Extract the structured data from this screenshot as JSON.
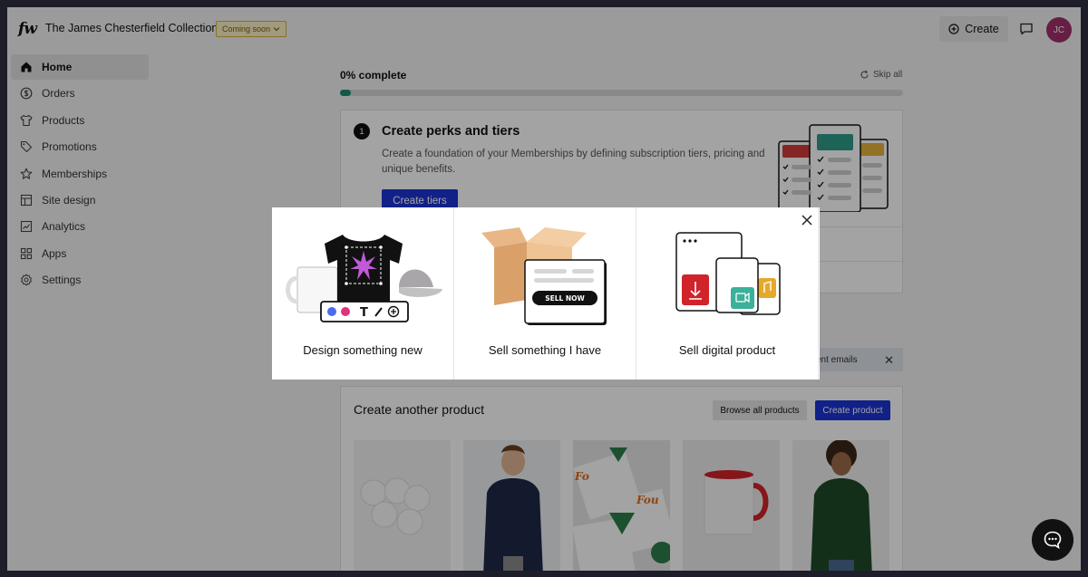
{
  "header": {
    "logo": "fw",
    "store_name": "The James Chesterfield Collection",
    "badge": "Coming soon",
    "create_label": "Create",
    "avatar_initials": "JC"
  },
  "sidebar": {
    "items": [
      {
        "label": "Home",
        "icon": "home-icon"
      },
      {
        "label": "Orders",
        "icon": "dollar-icon"
      },
      {
        "label": "Products",
        "icon": "shirt-icon"
      },
      {
        "label": "Promotions",
        "icon": "tag-icon"
      },
      {
        "label": "Memberships",
        "icon": "star-icon"
      },
      {
        "label": "Site design",
        "icon": "layout-icon"
      },
      {
        "label": "Analytics",
        "icon": "chart-icon"
      },
      {
        "label": "Apps",
        "icon": "grid-icon"
      },
      {
        "label": "Settings",
        "icon": "gear-icon"
      }
    ]
  },
  "progress": {
    "label": "0% complete",
    "skip_label": "Skip all",
    "value_percent": 0
  },
  "perks_card": {
    "step": "1",
    "title": "Create perks and tiers",
    "description": "Create a foundation of your Memberships by defining subscription tiers, pricing and unique benefits.",
    "button_label": "Create tiers"
  },
  "notification": {
    "text": "ent emails"
  },
  "another_product": {
    "title": "Create another product",
    "browse_label": "Browse all products",
    "create_label": "Create product"
  },
  "modal": {
    "options": [
      {
        "label": "Design something new"
      },
      {
        "label": "Sell something I have",
        "box_label": "SELL NOW"
      },
      {
        "label": "Sell digital product"
      }
    ]
  },
  "colors": {
    "accent_blue": "#1c34d4",
    "progress_green": "#1f8c76",
    "avatar": "#a0306d",
    "badge_bg": "#fbf1c7"
  }
}
